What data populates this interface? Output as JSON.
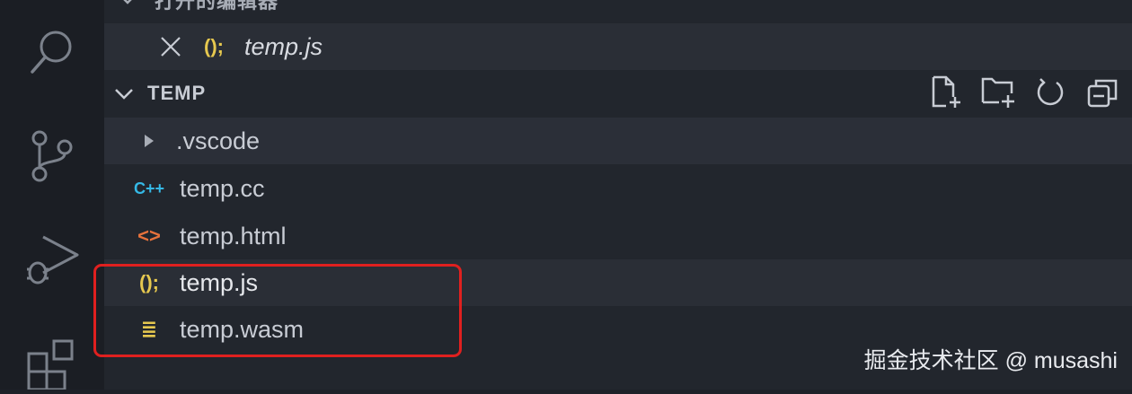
{
  "activity_bar": {
    "icons": [
      "search-icon",
      "source-control-icon",
      "run-debug-icon",
      "extensions-icon"
    ]
  },
  "open_editors": {
    "header": "打开的编辑器",
    "items": [
      {
        "name": "temp.js",
        "icon_glyph": "();",
        "icon": "javascript-icon"
      }
    ]
  },
  "workspace": {
    "title": "TEMP",
    "toolbar": [
      "new-file-icon",
      "new-folder-icon",
      "refresh-icon",
      "collapse-all-icon"
    ],
    "items": [
      {
        "name": ".vscode",
        "type": "folder"
      },
      {
        "name": "temp.cc",
        "icon_glyph": "C++",
        "icon": "cpp-icon"
      },
      {
        "name": "temp.html",
        "icon_glyph": "<>",
        "icon": "html-icon"
      },
      {
        "name": "temp.js",
        "icon_glyph": "();",
        "icon": "javascript-icon"
      },
      {
        "name": "temp.wasm",
        "icon_glyph": "≣",
        "icon": "wasm-icon"
      }
    ]
  },
  "colors": {
    "accent_js": "#e6c84f",
    "accent_cc": "#35b9e6",
    "accent_html": "#e7723c",
    "highlight": "#e0201f"
  },
  "watermark": "掘金技术社区 @ musashi"
}
